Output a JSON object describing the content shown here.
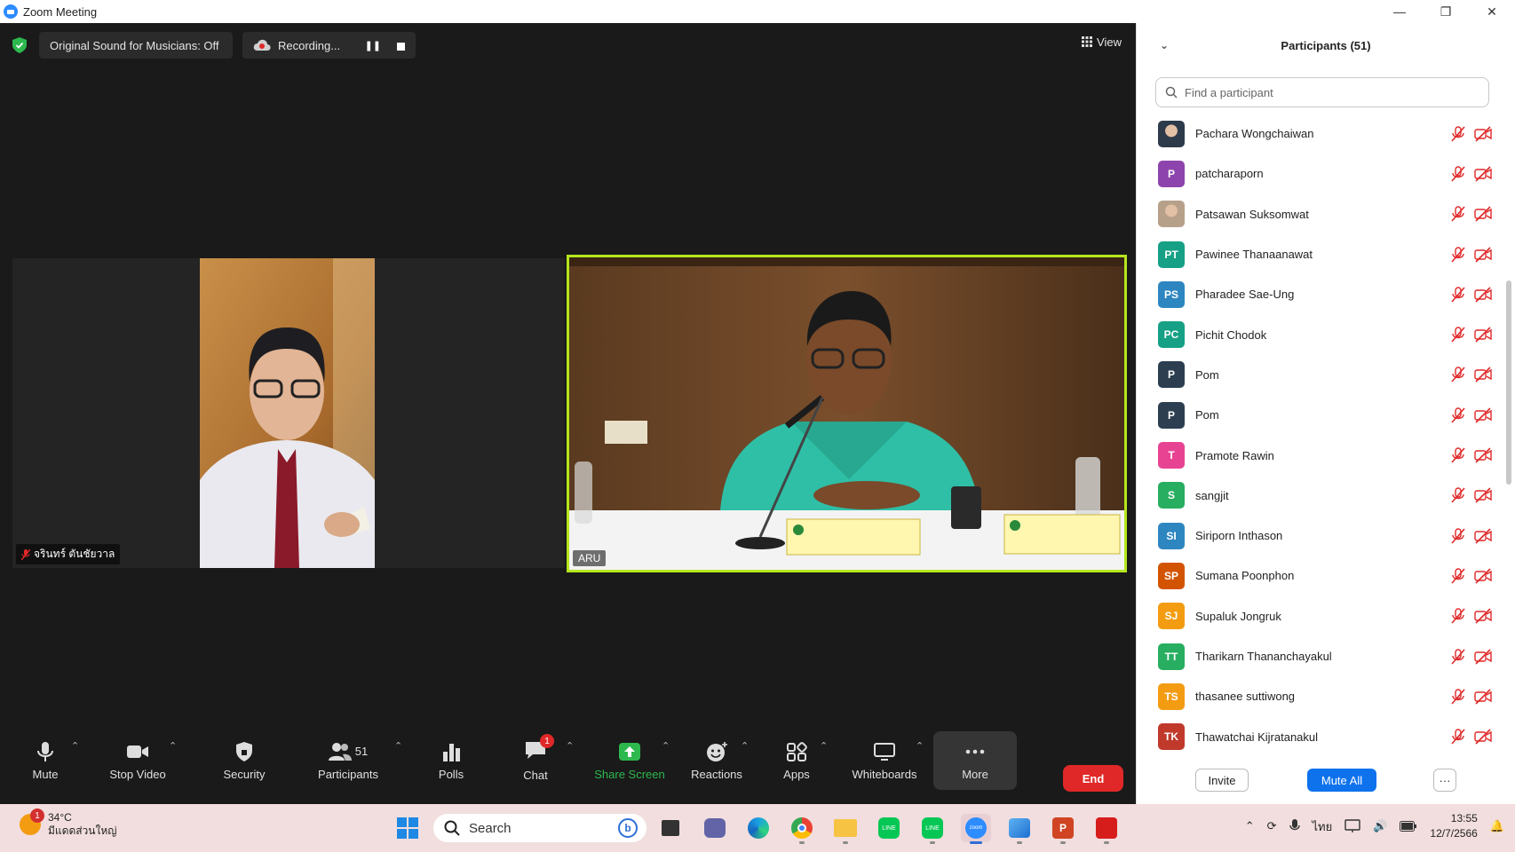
{
  "window": {
    "title": "Zoom Meeting",
    "minimize": "—",
    "restore": "❐",
    "close": "✕"
  },
  "meeting_top": {
    "original_sound": "Original Sound for Musicians: Off",
    "recording": "Recording...",
    "view": "View"
  },
  "videos": {
    "left_name": "จรินทร์ ตันชัยวาล",
    "right_name": "ARU"
  },
  "toolbar": {
    "mute": "Mute",
    "stop_video": "Stop Video",
    "security": "Security",
    "participants": "Participants",
    "participants_count": "51",
    "polls": "Polls",
    "chat": "Chat",
    "chat_badge": "1",
    "share_screen": "Share Screen",
    "reactions": "Reactions",
    "apps": "Apps",
    "whiteboards": "Whiteboards",
    "more": "More",
    "end": "End"
  },
  "panel": {
    "title": "Participants (51)",
    "search_placeholder": "Find a participant",
    "participants": [
      {
        "name": "Pachara Wongchaiwan",
        "initials": "",
        "color": "#2d3a4a",
        "photo": true
      },
      {
        "name": "patcharaporn",
        "initials": "P",
        "color": "#8e44ad",
        "photo": false
      },
      {
        "name": "Patsawan Suksomwat",
        "initials": "",
        "color": "#b7a08a",
        "photo": true
      },
      {
        "name": "Pawinee Thanaanawat",
        "initials": "PT",
        "color": "#16a085",
        "photo": false
      },
      {
        "name": "Pharadee Sae-Ung",
        "initials": "PS",
        "color": "#2e86c1",
        "photo": false
      },
      {
        "name": "Pichit Chodok",
        "initials": "PC",
        "color": "#16a085",
        "photo": false
      },
      {
        "name": "Pom",
        "initials": "P",
        "color": "#2c3e50",
        "photo": false
      },
      {
        "name": "Pom",
        "initials": "P",
        "color": "#2c3e50",
        "photo": false
      },
      {
        "name": "Pramote Rawin",
        "initials": "T",
        "color": "#e84393",
        "photo": false
      },
      {
        "name": "sangjit",
        "initials": "S",
        "color": "#27ae60",
        "photo": false
      },
      {
        "name": "Siriporn Inthason",
        "initials": "SI",
        "color": "#2e86c1",
        "photo": false
      },
      {
        "name": "Sumana Poonphon",
        "initials": "SP",
        "color": "#d35400",
        "photo": false
      },
      {
        "name": "Supaluk Jongruk",
        "initials": "SJ",
        "color": "#f39c12",
        "photo": false
      },
      {
        "name": "Tharikarn Thananchayakul",
        "initials": "TT",
        "color": "#27ae60",
        "photo": false
      },
      {
        "name": "thasanee suttiwong",
        "initials": "TS",
        "color": "#f39c12",
        "photo": false
      },
      {
        "name": "Thawatchai Kijratanakul",
        "initials": "TK",
        "color": "#c0392b",
        "photo": false
      }
    ],
    "invite": "Invite",
    "mute_all": "Mute All",
    "more": "···"
  },
  "taskbar": {
    "weather_temp": "34°C",
    "weather_desc": "มีแดดส่วนใหญ่",
    "weather_badge": "1",
    "search": "Search",
    "lang": "ไทย",
    "time": "13:55",
    "date": "12/7/2566"
  },
  "colors": {
    "accent_blue": "#0e72ed",
    "end_red": "#e02828",
    "share_green": "#2db84d",
    "active_speaker": "#b5e61d"
  }
}
